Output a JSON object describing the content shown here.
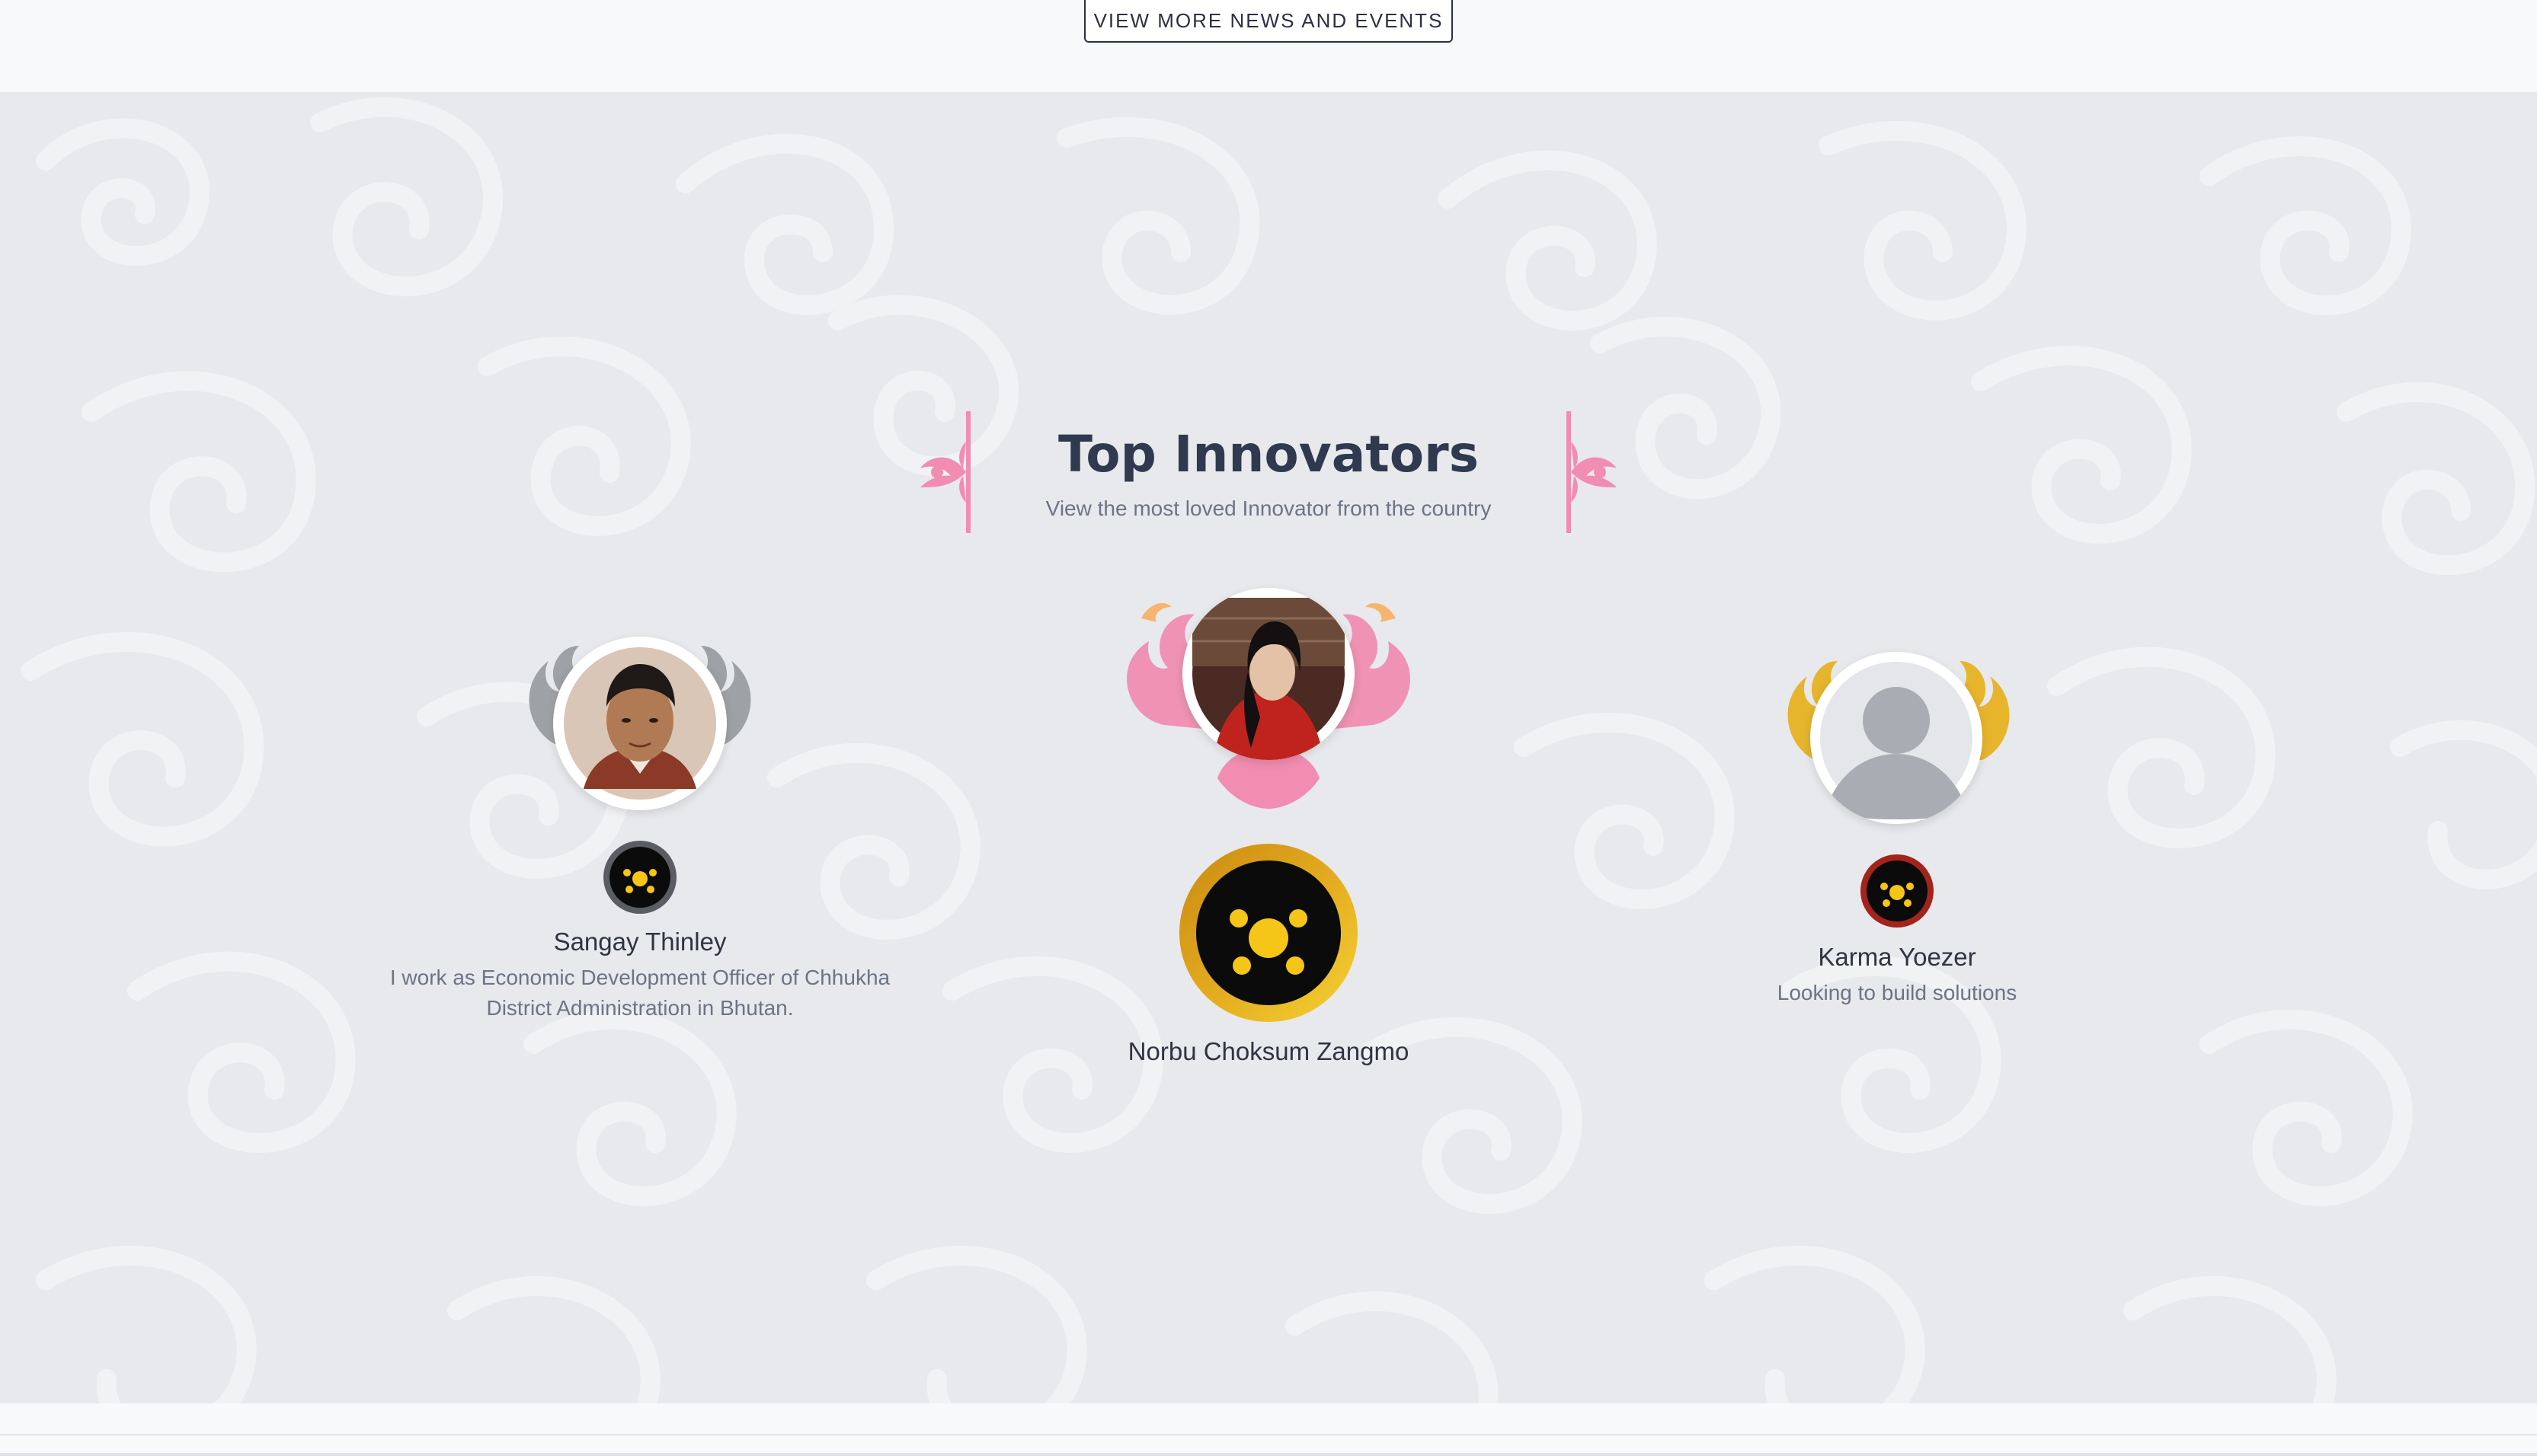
{
  "news": {
    "view_more_label": "VIEW MORE NEWS AND EVENTS"
  },
  "innovators": {
    "title": "Top Innovators",
    "subtitle": "View the most loved Innovator from the country",
    "people": [
      {
        "rank": 2,
        "name": "Sangay Thinley",
        "bio_line1": "I work as Economic Development Officer of Chhukha",
        "bio_line2": "District Administration in Bhutan.",
        "ornament_color": "#9ea1a6",
        "badge_ring_color": "#5a5d63"
      },
      {
        "rank": 1,
        "name": "Norbu Choksum Zangmo",
        "bio_line1": "",
        "ornament_color": "#f08db0",
        "badge_ring_color": "#d9a520"
      },
      {
        "rank": 3,
        "name": "Karma Yoezer",
        "bio_line1": "Looking to build solutions",
        "ornament_color": "#e6b52c",
        "badge_ring_color": "#a3231d"
      }
    ]
  },
  "colors": {
    "section_bg": "#e8e9ec",
    "title": "#2f3a50",
    "subtitle": "#6b7486",
    "badge_gold": "#f5c518",
    "pattern": "#f1f2f4"
  }
}
